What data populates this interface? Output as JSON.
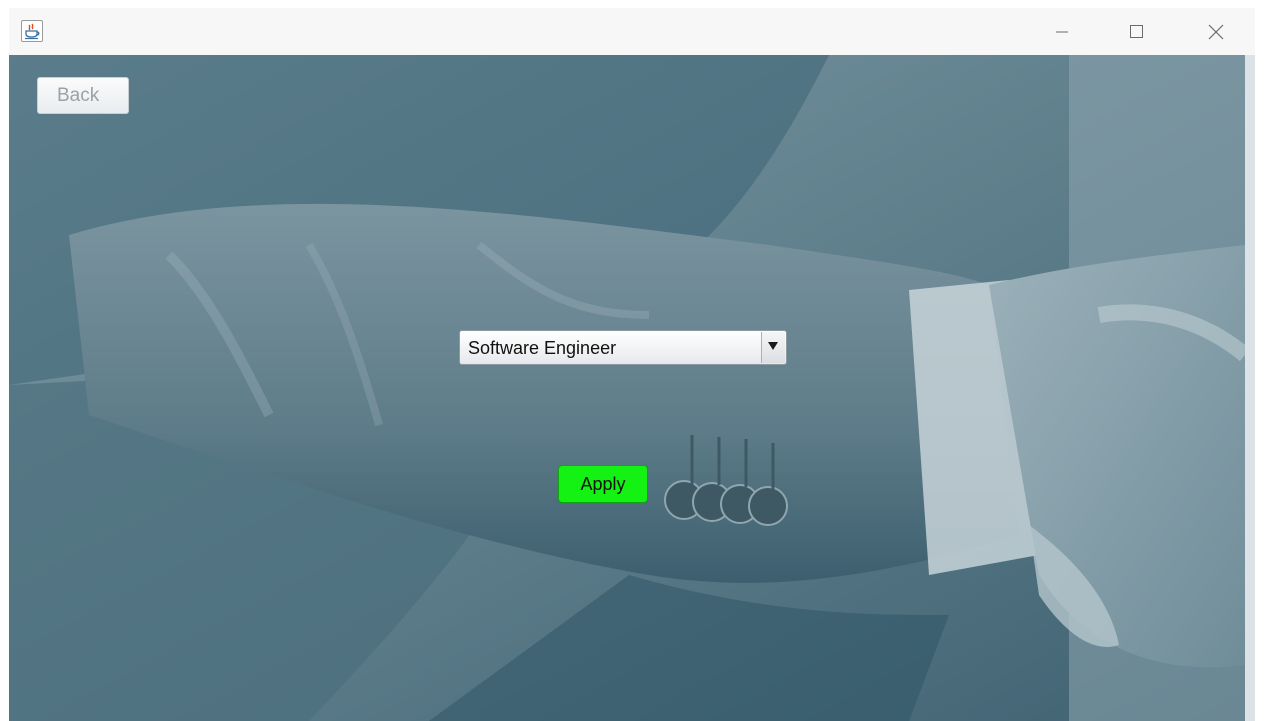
{
  "window": {
    "controls": [
      "minimize-icon",
      "maximize-icon",
      "close-icon"
    ],
    "app_icon": "java-cup-icon"
  },
  "background": {
    "tint_color": "#5e7f8c",
    "description_hidden": true
  },
  "back_button": {
    "label": "Back"
  },
  "job_select": {
    "selected": "Software Engineer",
    "arrow_icon": "triangle-down-icon"
  },
  "apply_button": {
    "label": "Apply",
    "color": "#13f213"
  }
}
